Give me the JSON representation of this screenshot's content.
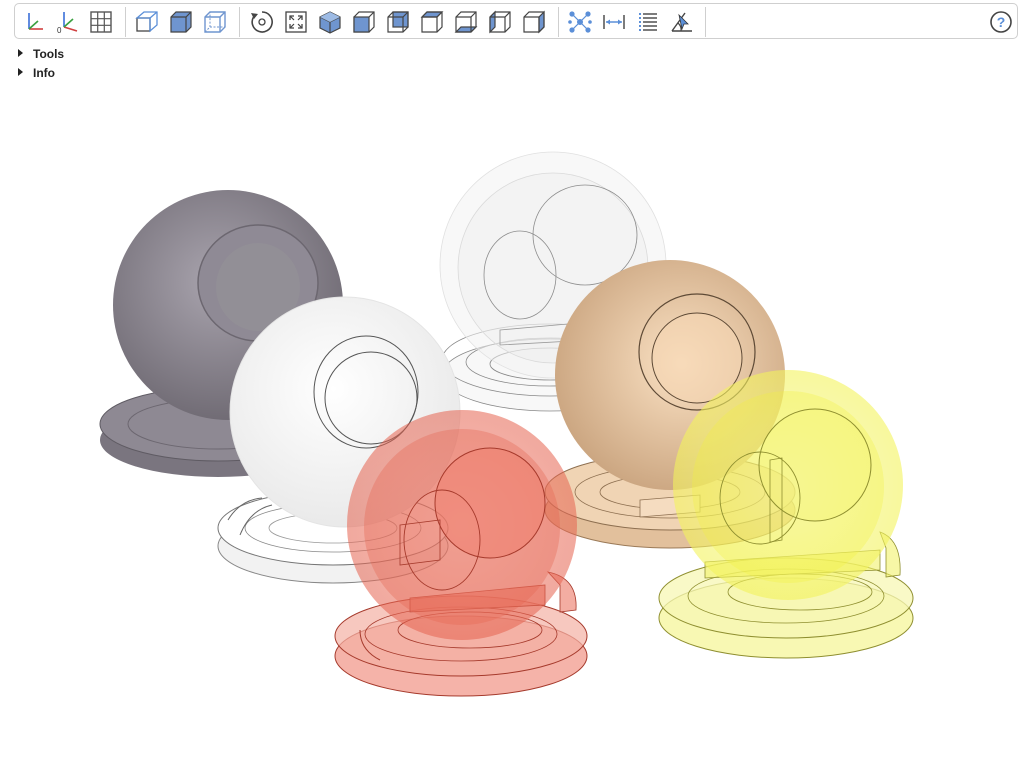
{
  "toolbar": {
    "buttons": [
      {
        "name": "axes-icon"
      },
      {
        "name": "axes-origin-icon"
      },
      {
        "name": "grid-icon"
      },
      {
        "name": "perspective-view-icon"
      },
      {
        "name": "shaded-view-icon"
      },
      {
        "name": "wireframe-view-icon"
      },
      {
        "name": "reset-view-icon"
      },
      {
        "name": "fit-view-icon"
      },
      {
        "name": "iso-view-icon"
      },
      {
        "name": "front-view-icon"
      },
      {
        "name": "back-view-icon"
      },
      {
        "name": "top-view-icon"
      },
      {
        "name": "bottom-view-icon"
      },
      {
        "name": "left-view-icon"
      },
      {
        "name": "right-view-icon"
      },
      {
        "name": "explode-icon"
      },
      {
        "name": "distance-measure-icon"
      },
      {
        "name": "properties-icon"
      },
      {
        "name": "angle-measure-icon"
      },
      {
        "name": "help-icon"
      }
    ]
  },
  "tree": {
    "tools_label": "Tools",
    "info_label": "Info"
  },
  "scene": {
    "objects": [
      {
        "name": "gray-sphere-model",
        "color": "#8c8792"
      },
      {
        "name": "clear-sphere-model",
        "color": "#f2f2f2"
      },
      {
        "name": "white-sphere-model",
        "color": "#ffffff"
      },
      {
        "name": "tan-sphere-model",
        "color": "#e3bc94"
      },
      {
        "name": "red-sphere-model",
        "color": "#e8604c"
      },
      {
        "name": "yellow-sphere-model",
        "color": "#f2f23a"
      }
    ]
  }
}
